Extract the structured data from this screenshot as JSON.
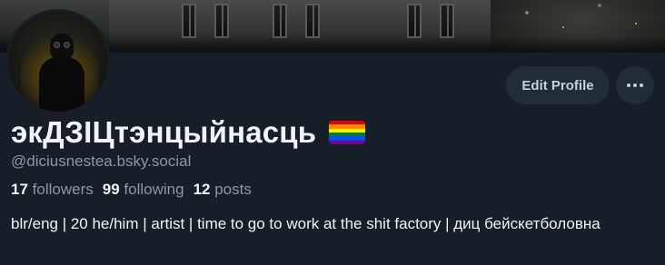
{
  "profile": {
    "display_name": "экДЗІЦтэнцыйнасць",
    "handle": "@diciusnestea.bsky.social",
    "bio": "blr/eng | 20 he/him | artist | time to go to work at the shit factory | диц бейскетболовна",
    "flag_colors": [
      "#e40303",
      "#ff8c00",
      "#ffed00",
      "#008026",
      "#004dff",
      "#750787"
    ]
  },
  "stats": {
    "followers": {
      "count": "17",
      "label": "followers"
    },
    "following": {
      "count": "99",
      "label": "following"
    },
    "posts": {
      "count": "12",
      "label": "posts"
    }
  },
  "actions": {
    "edit_profile_label": "Edit Profile",
    "more_icon": "ellipsis-horizontal-icon"
  },
  "colors": {
    "background": "#161e27",
    "button_bg": "#222c37",
    "muted_text": "#8b98a5",
    "primary_text": "#f1f3f5"
  }
}
